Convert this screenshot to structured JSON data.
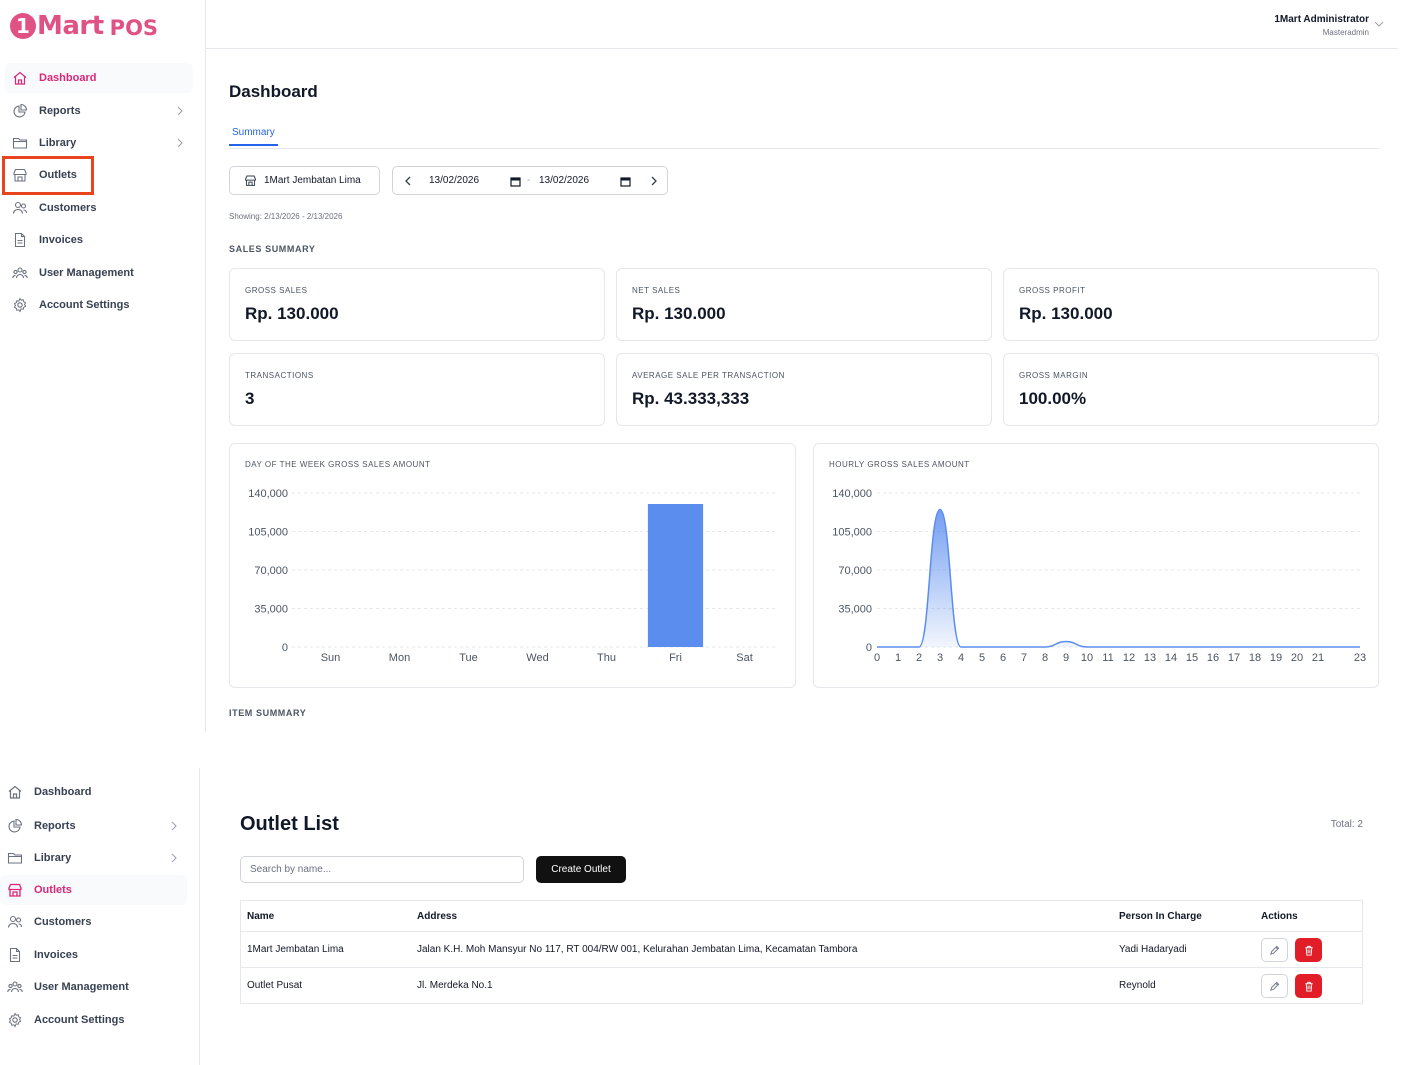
{
  "brand": {
    "mark": "1",
    "name": "Mart",
    "suffix": "POS"
  },
  "user": {
    "name": "1Mart Administrator",
    "role": "Masteradmin"
  },
  "sidebar_top": {
    "items": [
      {
        "label": "Dashboard",
        "icon": "home-icon",
        "active": true
      },
      {
        "label": "Reports",
        "icon": "pie-chart-icon",
        "chevron": true
      },
      {
        "label": "Library",
        "icon": "folder-icon",
        "chevron": true
      },
      {
        "label": "Outlets",
        "icon": "store-icon",
        "highlighted": true
      },
      {
        "label": "Customers",
        "icon": "users-icon"
      },
      {
        "label": "Invoices",
        "icon": "document-icon"
      },
      {
        "label": "User Management",
        "icon": "user-group-icon"
      },
      {
        "label": "Account Settings",
        "icon": "gear-icon"
      }
    ]
  },
  "dashboard": {
    "title": "Dashboard",
    "tab": "Summary",
    "outlet": "1Mart Jembatan Lima",
    "date_from": "13/02/2026",
    "date_separator": "-",
    "date_to": "13/02/2026",
    "showing": "Showing: 2/13/2026 - 2/13/2026",
    "sales_summary_title": "SALES SUMMARY",
    "cards": [
      {
        "label": "GROSS SALES",
        "value": "Rp. 130.000"
      },
      {
        "label": "NET SALES",
        "value": "Rp. 130.000"
      },
      {
        "label": "GROSS PROFIT",
        "value": "Rp. 130.000"
      },
      {
        "label": "TRANSACTIONS",
        "value": "3"
      },
      {
        "label": "AVERAGE SALE PER TRANSACTION",
        "value": "Rp. 43.333,333"
      },
      {
        "label": "GROSS MARGIN",
        "value": "100.00%"
      }
    ],
    "item_summary_title": "ITEM SUMMARY"
  },
  "chart_data": [
    {
      "type": "bar",
      "title": "DAY OF THE WEEK GROSS SALES AMOUNT",
      "categories": [
        "Sun",
        "Mon",
        "Tue",
        "Wed",
        "Thu",
        "Fri",
        "Sat"
      ],
      "values": [
        0,
        0,
        0,
        0,
        0,
        130000,
        0
      ],
      "yticks": [
        "0",
        "35,000",
        "70,000",
        "105,000",
        "140,000"
      ],
      "ylim": [
        0,
        140000
      ],
      "grid": "dashed horizontal",
      "color": "#5b8def"
    },
    {
      "type": "area",
      "title": "HOURLY GROSS SALES AMOUNT",
      "x": [
        0,
        1,
        2,
        3,
        4,
        5,
        6,
        7,
        8,
        9,
        10,
        11,
        12,
        13,
        14,
        15,
        16,
        17,
        18,
        19,
        20,
        21,
        22,
        23
      ],
      "xticks": [
        "0",
        "1",
        "2",
        "3",
        "4",
        "5",
        "6",
        "7",
        "8",
        "9",
        "10",
        "11",
        "12",
        "13",
        "14",
        "15",
        "16",
        "17",
        "18",
        "19",
        "20",
        "21",
        "23"
      ],
      "values": [
        0,
        0,
        0,
        125000,
        0,
        0,
        0,
        0,
        0,
        5000,
        0,
        0,
        0,
        0,
        0,
        0,
        0,
        0,
        0,
        0,
        0,
        0,
        0,
        0
      ],
      "yticks": [
        "0",
        "35,000",
        "70,000",
        "105,000",
        "140,000"
      ],
      "ylim": [
        0,
        140000
      ],
      "grid": "dashed horizontal",
      "color": "#5b8def"
    }
  ],
  "sidebar_bottom": {
    "items": [
      {
        "label": "Dashboard",
        "icon": "home-icon"
      },
      {
        "label": "Reports",
        "icon": "pie-chart-icon",
        "chevron": true
      },
      {
        "label": "Library",
        "icon": "folder-icon",
        "chevron": true
      },
      {
        "label": "Outlets",
        "icon": "store-icon",
        "active": true
      },
      {
        "label": "Customers",
        "icon": "users-icon"
      },
      {
        "label": "Invoices",
        "icon": "document-icon"
      },
      {
        "label": "User Management",
        "icon": "user-group-icon"
      },
      {
        "label": "Account Settings",
        "icon": "gear-icon"
      }
    ]
  },
  "outlet_list": {
    "title": "Outlet List",
    "total": "Total: 2",
    "search_placeholder": "Search by name...",
    "create_label": "Create Outlet",
    "columns": [
      "Name",
      "Address",
      "Person In Charge",
      "Actions"
    ],
    "rows": [
      {
        "name": "1Mart Jembatan Lima",
        "address": "Jalan K.H. Moh Mansyur No 117, RT 004/RW 001, Kelurahan Jembatan Lima, Kecamatan Tambora",
        "pic": "Yadi Hadaryadi"
      },
      {
        "name": "Outlet Pusat",
        "address": "Jl. Merdeka No.1",
        "pic": "Reynold"
      }
    ]
  },
  "colors": {
    "brand": "#e05283",
    "active": "#db2777",
    "accent": "#2563eb",
    "danger": "#e11d27",
    "highlight": "#e8441e"
  }
}
